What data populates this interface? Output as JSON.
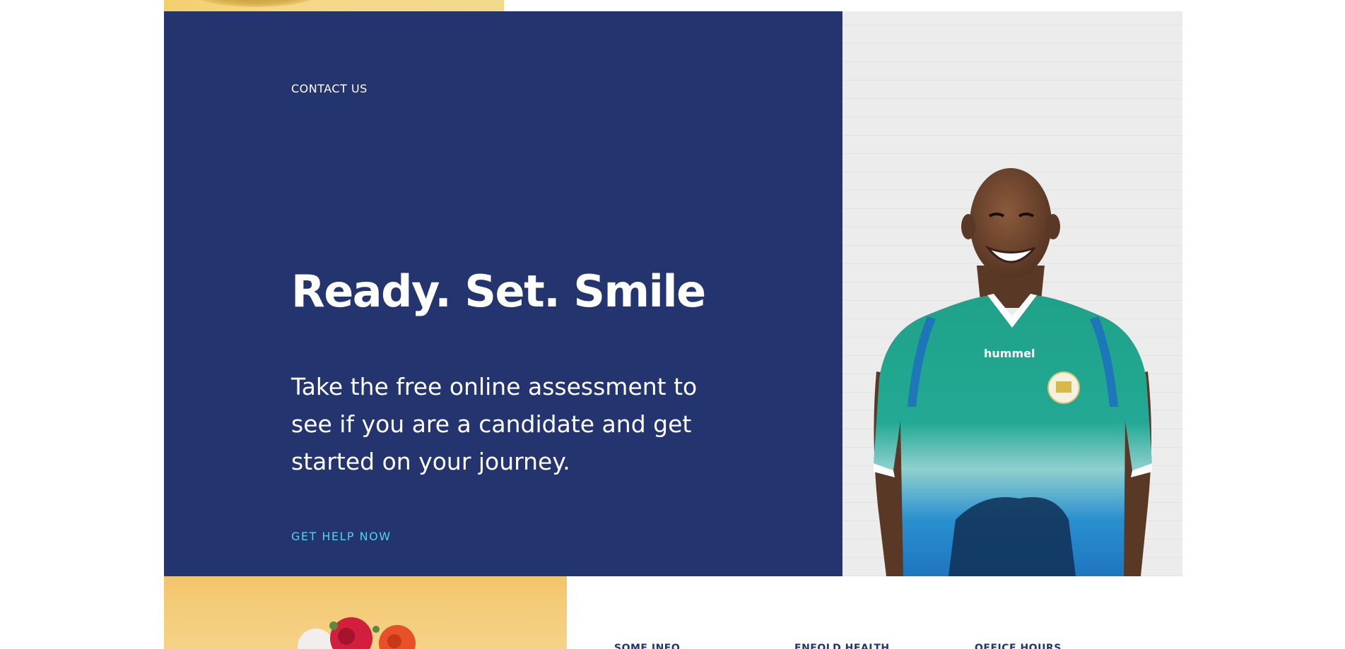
{
  "contact": {
    "eyebrow": "CONTACT US",
    "headline": "Ready. Set. Smile",
    "body": "Take the free online assessment to see if you are a candidate and get started on your journey.",
    "cta_label": "GET HELP NOW"
  },
  "photo": {
    "shirt_brand": "hummel"
  },
  "footer": {
    "columns": [
      {
        "title": "SOME INFO"
      },
      {
        "title": "ENFOLD HEALTH"
      },
      {
        "title": "OFFICE HOURS"
      }
    ]
  },
  "colors": {
    "panel_bg": "#24346e",
    "accent_link": "#4fd3f0",
    "yellow": "#f2c56b",
    "jersey_green": "#1f9f86",
    "jersey_blue": "#2386c8"
  }
}
